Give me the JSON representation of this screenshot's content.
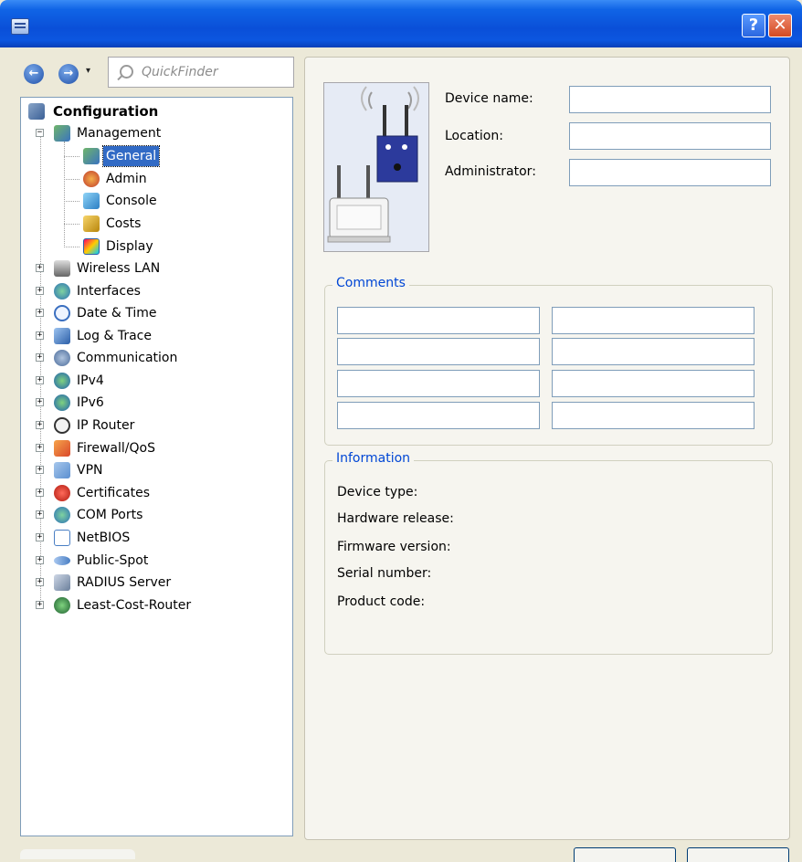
{
  "titlebar": {
    "help_glyph": "?",
    "close_glyph": "✕"
  },
  "nav": {
    "back_glyph": "←",
    "forward_glyph": "→",
    "dropdown_glyph": "▾",
    "quickfinder_placeholder": "QuickFinder"
  },
  "tree": {
    "root": "Configuration",
    "management": "Management",
    "management_children": [
      "General",
      "Admin",
      "Console",
      "Costs",
      "Display"
    ],
    "top_items": [
      "Wireless LAN",
      "Interfaces",
      "Date & Time",
      "Log & Trace",
      "Communication",
      "IPv4",
      "IPv6",
      "IP Router",
      "Firewall/QoS",
      "VPN",
      "Certificates",
      "COM Ports",
      "NetBIOS",
      "Public-Spot",
      "RADIUS Server",
      "Least-Cost-Router"
    ],
    "expand_glyph": "+",
    "collapse_glyph": "−"
  },
  "form": {
    "device_name_label": "Device name:",
    "location_label": "Location:",
    "administrator_label": "Administrator:",
    "device_name_value": "",
    "location_value": "",
    "administrator_value": ""
  },
  "comments": {
    "title": "Comments",
    "fields": [
      "",
      "",
      "",
      "",
      "",
      "",
      "",
      ""
    ]
  },
  "information": {
    "title": "Information",
    "labels": [
      "Device type:",
      "Hardware release:",
      "Firmware version:",
      "Serial number:",
      "Product code:"
    ]
  },
  "colors": {
    "selection": "#316ac5",
    "group_title": "#0046d5",
    "titlebar": "#0a4fd8"
  }
}
